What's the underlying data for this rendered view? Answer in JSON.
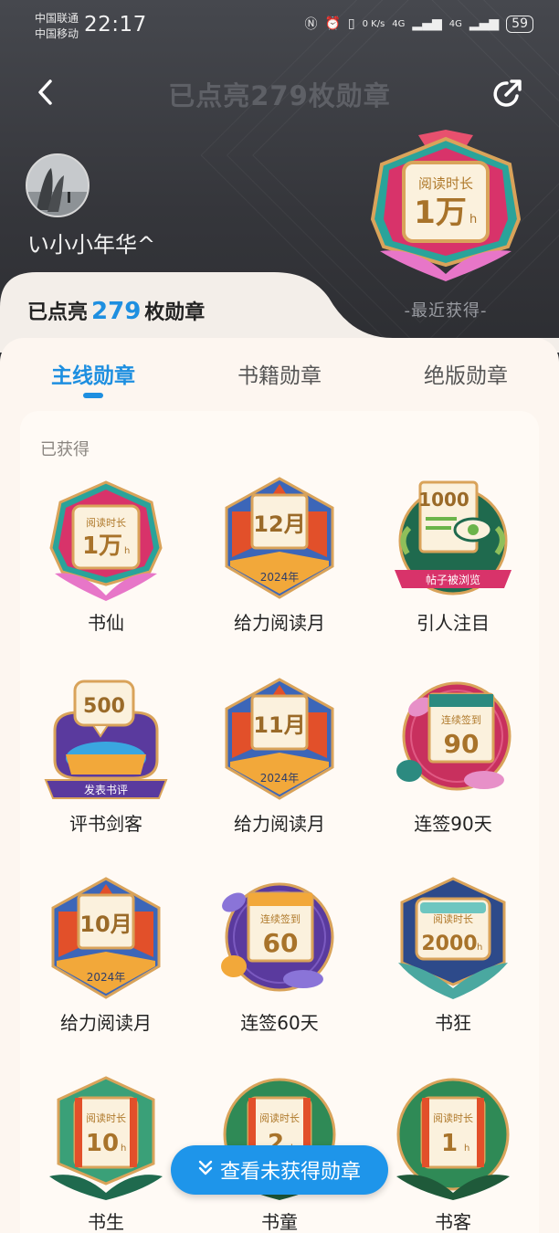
{
  "status_bar": {
    "carrier_1": "中国联通",
    "carrier_2": "中国移动",
    "time": "22:17",
    "net_speed": "0 K/s",
    "net_1": "4G",
    "net_2": "4G",
    "battery": "59"
  },
  "nav": {
    "title": "已点亮279枚勋章",
    "back_icon": "back-arrow-icon",
    "share_icon": "share-icon"
  },
  "profile": {
    "username": "い小小年华^",
    "lit_prefix": "已点亮",
    "lit_count": "279",
    "lit_suffix": "枚勋章"
  },
  "featured_badge": {
    "line1": "阅读时长",
    "line2": "1万",
    "unit": "h",
    "caption": "-最近获得-"
  },
  "tabs": [
    {
      "label": "主线勋章",
      "active": true
    },
    {
      "label": "书籍勋章",
      "active": false
    },
    {
      "label": "绝版勋章",
      "active": false
    }
  ],
  "section_title": "已获得",
  "badges": [
    {
      "name": "书仙",
      "text_top": "阅读时长",
      "text_main": "1万",
      "unit": "h",
      "style": "reading-pink"
    },
    {
      "name": "给力阅读月",
      "text_main": "12月",
      "text_bottom": "2024年",
      "style": "month"
    },
    {
      "name": "引人注目",
      "text_main": "1000",
      "text_bottom": "帖子被浏览",
      "style": "viewed"
    },
    {
      "name": "评书剑客",
      "text_main": "500",
      "text_bottom": "发表书评",
      "style": "review"
    },
    {
      "name": "给力阅读月",
      "text_main": "11月",
      "text_bottom": "2024年",
      "style": "month"
    },
    {
      "name": "连签90天",
      "text_top": "连续签到",
      "text_main": "90",
      "style": "signin-pink"
    },
    {
      "name": "给力阅读月",
      "text_main": "10月",
      "text_bottom": "2024年",
      "style": "month"
    },
    {
      "name": "连签60天",
      "text_top": "连续签到",
      "text_main": "60",
      "style": "signin-purple"
    },
    {
      "name": "书狂",
      "text_top": "阅读时长",
      "text_main": "2000",
      "unit": "h",
      "style": "reading-blue"
    },
    {
      "name": "书生",
      "text_top": "阅读时长",
      "text_main": "10",
      "unit": "h",
      "style": "reading-teal"
    },
    {
      "name": "书童",
      "text_top": "阅读时长",
      "text_main": "2",
      "unit": "h",
      "style": "reading-green"
    },
    {
      "name": "书客",
      "text_top": "阅读时长",
      "text_main": "1",
      "unit": "h",
      "style": "reading-green"
    }
  ],
  "fab": {
    "label": "查看未获得勋章",
    "icon": "double-chevron-down-icon"
  },
  "colors": {
    "accent": "#1e8fe0",
    "panel": "#fdf6f0",
    "header": "#3a3b40"
  }
}
